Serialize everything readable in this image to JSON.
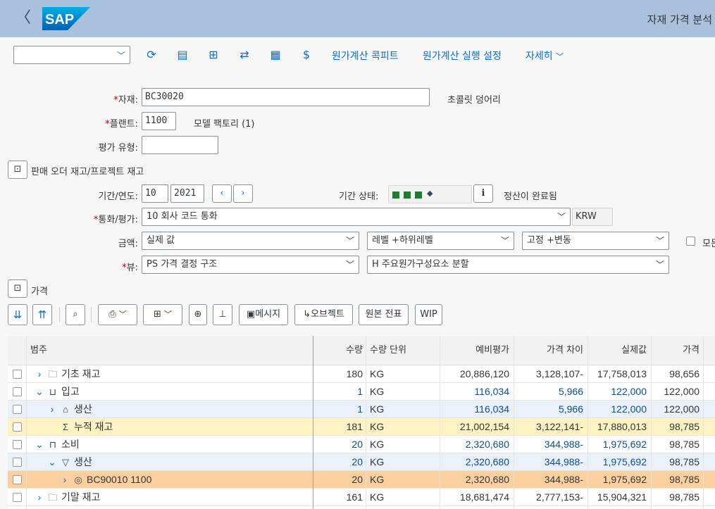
{
  "shell": {
    "back_glyph": "〈",
    "logo_text": "SAP",
    "title": "자재 가격 분석"
  },
  "toolbar": {
    "variant_value": "",
    "icons": [
      "refresh-icon",
      "cost-component-icon",
      "hierarchy-icon",
      "sync-icon",
      "calculator-icon",
      "money-bag-icon"
    ],
    "cockpit_label": "원가계산 콕피트",
    "run_settings_label": "원가계산 실행 설정",
    "more_label": "자세히"
  },
  "form": {
    "material_label": "자재:",
    "material_value": "BC30020",
    "material_desc": "초콜릿 덩어리",
    "plant_label": "플랜트:",
    "plant_value": "1100",
    "plant_desc": "모델 팩토리 (1)",
    "valuation_type_label": "평가 유형:",
    "valuation_type_value": "",
    "sales_order_label": "판매 오더 재고/프로젝트 재고",
    "period_label": "기간/연도:",
    "period_value": "10",
    "year_value": "2021",
    "period_status_label": "기간 상태:",
    "settlement_text": "정산이 완료됨",
    "currency_label": "통화/평가:",
    "currency_value": "10 회사 코드 통화",
    "currency_code": "KRW",
    "amount_label": "금액:",
    "amount_value": "실제 값",
    "level_value": "레벨 +하위레벨",
    "fixed_value": "고정 +변동",
    "all_checkbox_label": "모든",
    "view_label": "뷰:",
    "view_value": "PS 가격 결정 구조",
    "split_value": "H 주요원가구성요소 분할",
    "price_section_label": "가격"
  },
  "table_toolbar": {
    "message_label": "메시지",
    "object_label": "오브젝트",
    "original_doc_label": "원본 전표",
    "wip_label": "WIP"
  },
  "table": {
    "columns": [
      "범주",
      "수량",
      "수량 단위",
      "예비평가",
      "가격 차이",
      "실제값",
      "가격"
    ],
    "rows": [
      {
        "indent": 0,
        "toggle": "›",
        "icon": "folder-icon",
        "category": "기초 재고",
        "qty": "180",
        "unit": "KG",
        "prelim": "20,886,120",
        "variance": "3,128,107-",
        "actual": "17,758,013",
        "price": "98,656",
        "blue": false,
        "bg": "#ffffff"
      },
      {
        "indent": 0,
        "toggle": "⌄",
        "icon": "receipt-tray-icon",
        "category": "입고",
        "qty": "1",
        "unit": "KG",
        "prelim": "116,034",
        "variance": "5,966",
        "actual": "122,000",
        "price": "122,000",
        "blue": true,
        "bg": "#ffffff"
      },
      {
        "indent": 1,
        "toggle": "›",
        "icon": "production-icon",
        "category": "생산",
        "qty": "1",
        "unit": "KG",
        "prelim": "116,034",
        "variance": "5,966",
        "actual": "122,000",
        "price": "122,000",
        "blue": true,
        "bg": "#eaf1f9"
      },
      {
        "indent": 1,
        "toggle": "",
        "icon": "sum-icon",
        "category": "누적 재고",
        "qty": "181",
        "unit": "KG",
        "prelim": "21,002,154",
        "variance": "3,122,141-",
        "actual": "17,880,013",
        "price": "98,785",
        "blue": false,
        "bg": "#fdf2c2"
      },
      {
        "indent": 0,
        "toggle": "⌄",
        "icon": "consumption-tray-icon",
        "category": "소비",
        "qty": "20",
        "unit": "KG",
        "prelim": "2,320,680",
        "variance": "344,988-",
        "actual": "1,975,692",
        "price": "98,785",
        "blue": true,
        "bg": "#ffffff"
      },
      {
        "indent": 1,
        "toggle": "⌄",
        "icon": "production-out-icon",
        "category": "생산",
        "qty": "20",
        "unit": "KG",
        "prelim": "2,320,680",
        "variance": "344,988-",
        "actual": "1,975,692",
        "price": "98,785",
        "blue": true,
        "bg": "#eaf1f9"
      },
      {
        "indent": 2,
        "toggle": "›",
        "icon": "production-order-icon",
        "category": "BC90010 1100",
        "qty": "20",
        "unit": "KG",
        "prelim": "2,320,680",
        "variance": "344,988-",
        "actual": "1,975,692",
        "price": "98,785",
        "blue": false,
        "bg": "#fbcf9e"
      },
      {
        "indent": 0,
        "toggle": "›",
        "icon": "folder-icon",
        "category": "기말 재고",
        "qty": "161",
        "unit": "KG",
        "prelim": "18,681,474",
        "variance": "2,777,153-",
        "actual": "15,904,321",
        "price": "98,785",
        "blue": false,
        "bg": "#ffffff"
      }
    ]
  }
}
